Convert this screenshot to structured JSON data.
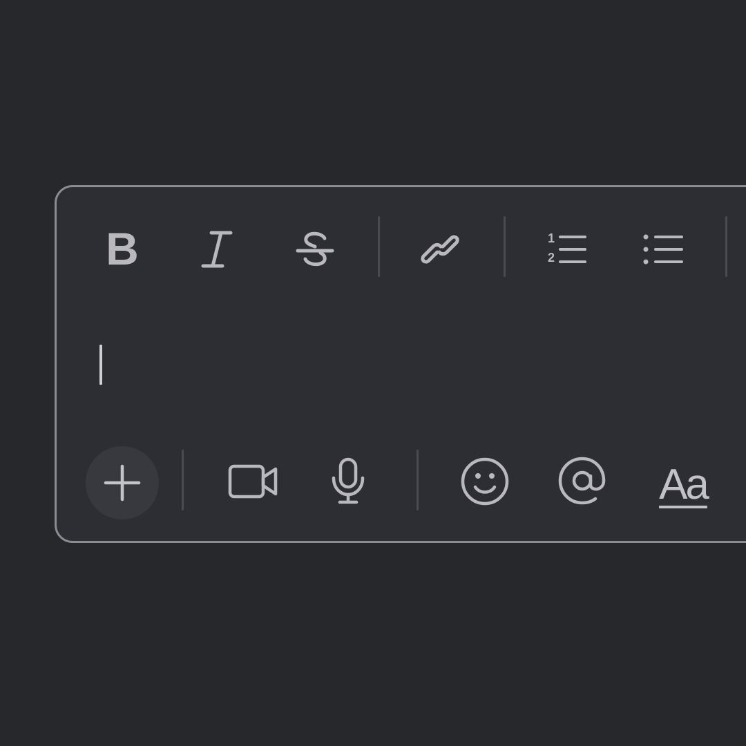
{
  "composer": {
    "editor": {
      "value": "",
      "has_caret": true
    },
    "format_toolbar": {
      "items": [
        {
          "name": "bold",
          "icon": "bold-icon"
        },
        {
          "name": "italic",
          "icon": "italic-icon"
        },
        {
          "name": "strikethrough",
          "icon": "strikethrough-icon"
        },
        {
          "name": "link",
          "icon": "link-icon"
        },
        {
          "name": "numbered-list",
          "icon": "numbered-list-icon"
        },
        {
          "name": "bulleted-list",
          "icon": "bulleted-list-icon"
        }
      ]
    },
    "action_toolbar": {
      "items": [
        {
          "name": "add",
          "icon": "plus-icon"
        },
        {
          "name": "video",
          "icon": "video-camera-icon"
        },
        {
          "name": "audio",
          "icon": "microphone-icon"
        },
        {
          "name": "emoji",
          "icon": "smiley-icon"
        },
        {
          "name": "mention",
          "icon": "at-sign-icon"
        },
        {
          "name": "formatting",
          "icon": "text-format-icon"
        }
      ],
      "formatting_label": "Aa"
    }
  },
  "colors": {
    "background": "#27282c",
    "composer_bg": "#2d2e33",
    "border": "#8c8c90",
    "icon": "#b9b9bd",
    "separator": "#4a4b50"
  }
}
